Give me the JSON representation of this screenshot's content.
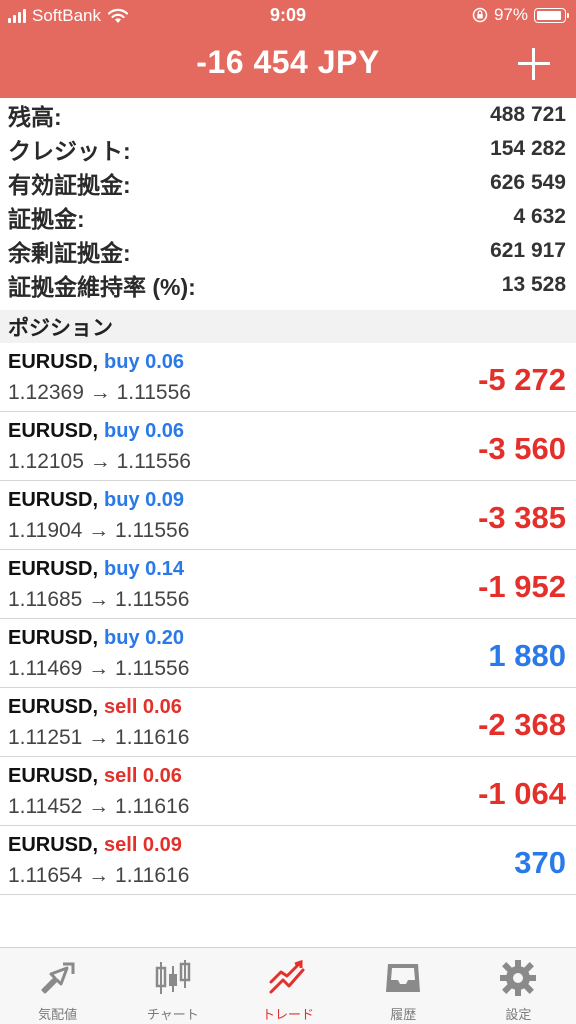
{
  "status_bar": {
    "carrier": "SoftBank",
    "time": "9:09",
    "battery_pct": "97%",
    "battery_level": 0.97
  },
  "header": {
    "title": "-16 454 JPY",
    "add_icon": "plus-icon"
  },
  "summary": [
    {
      "label": "残高:",
      "value": "488 721"
    },
    {
      "label": "クレジット:",
      "value": "154 282"
    },
    {
      "label": "有効証拠金:",
      "value": "626 549"
    },
    {
      "label": "証拠金:",
      "value": "4 632"
    },
    {
      "label": "余剰証拠金:",
      "value": "621 917"
    },
    {
      "label": "証拠金維持率 (%):",
      "value": "13 528"
    }
  ],
  "section_title": "ポジション",
  "positions": [
    {
      "symbol": "EURUSD,",
      "direction": "buy 0.06",
      "side": "buy",
      "prices": "1.12369 → 1.11556",
      "profit": "-5 272",
      "profit_sign": "neg"
    },
    {
      "symbol": "EURUSD,",
      "direction": "buy 0.06",
      "side": "buy",
      "prices": "1.12105 → 1.11556",
      "profit": "-3 560",
      "profit_sign": "neg"
    },
    {
      "symbol": "EURUSD,",
      "direction": "buy 0.09",
      "side": "buy",
      "prices": "1.11904 → 1.11556",
      "profit": "-3 385",
      "profit_sign": "neg"
    },
    {
      "symbol": "EURUSD,",
      "direction": "buy 0.14",
      "side": "buy",
      "prices": "1.11685 → 1.11556",
      "profit": "-1 952",
      "profit_sign": "neg"
    },
    {
      "symbol": "EURUSD,",
      "direction": "buy 0.20",
      "side": "buy",
      "prices": "1.11469 → 1.11556",
      "profit": "1 880",
      "profit_sign": "pos"
    },
    {
      "symbol": "EURUSD,",
      "direction": "sell 0.06",
      "side": "sell",
      "prices": "1.11251 → 1.11616",
      "profit": "-2 368",
      "profit_sign": "neg"
    },
    {
      "symbol": "EURUSD,",
      "direction": "sell 0.06",
      "side": "sell",
      "prices": "1.11452 → 1.11616",
      "profit": "-1 064",
      "profit_sign": "neg"
    },
    {
      "symbol": "EURUSD,",
      "direction": "sell 0.09",
      "side": "sell",
      "prices": "1.11654 → 1.11616",
      "profit": "370",
      "profit_sign": "pos"
    }
  ],
  "tabs": [
    {
      "label": "気配値",
      "icon": "quotes-icon",
      "active": false
    },
    {
      "label": "チャート",
      "icon": "chart-icon",
      "active": false
    },
    {
      "label": "トレード",
      "icon": "trade-icon",
      "active": true
    },
    {
      "label": "履歴",
      "icon": "history-icon",
      "active": false
    },
    {
      "label": "設定",
      "icon": "settings-icon",
      "active": false
    }
  ],
  "colors": {
    "header_bg": "#e46a5f",
    "buy": "#2a79e8",
    "sell": "#e3302a",
    "active_tab": "#e3302a",
    "inactive_tab": "#7a7a7a"
  }
}
